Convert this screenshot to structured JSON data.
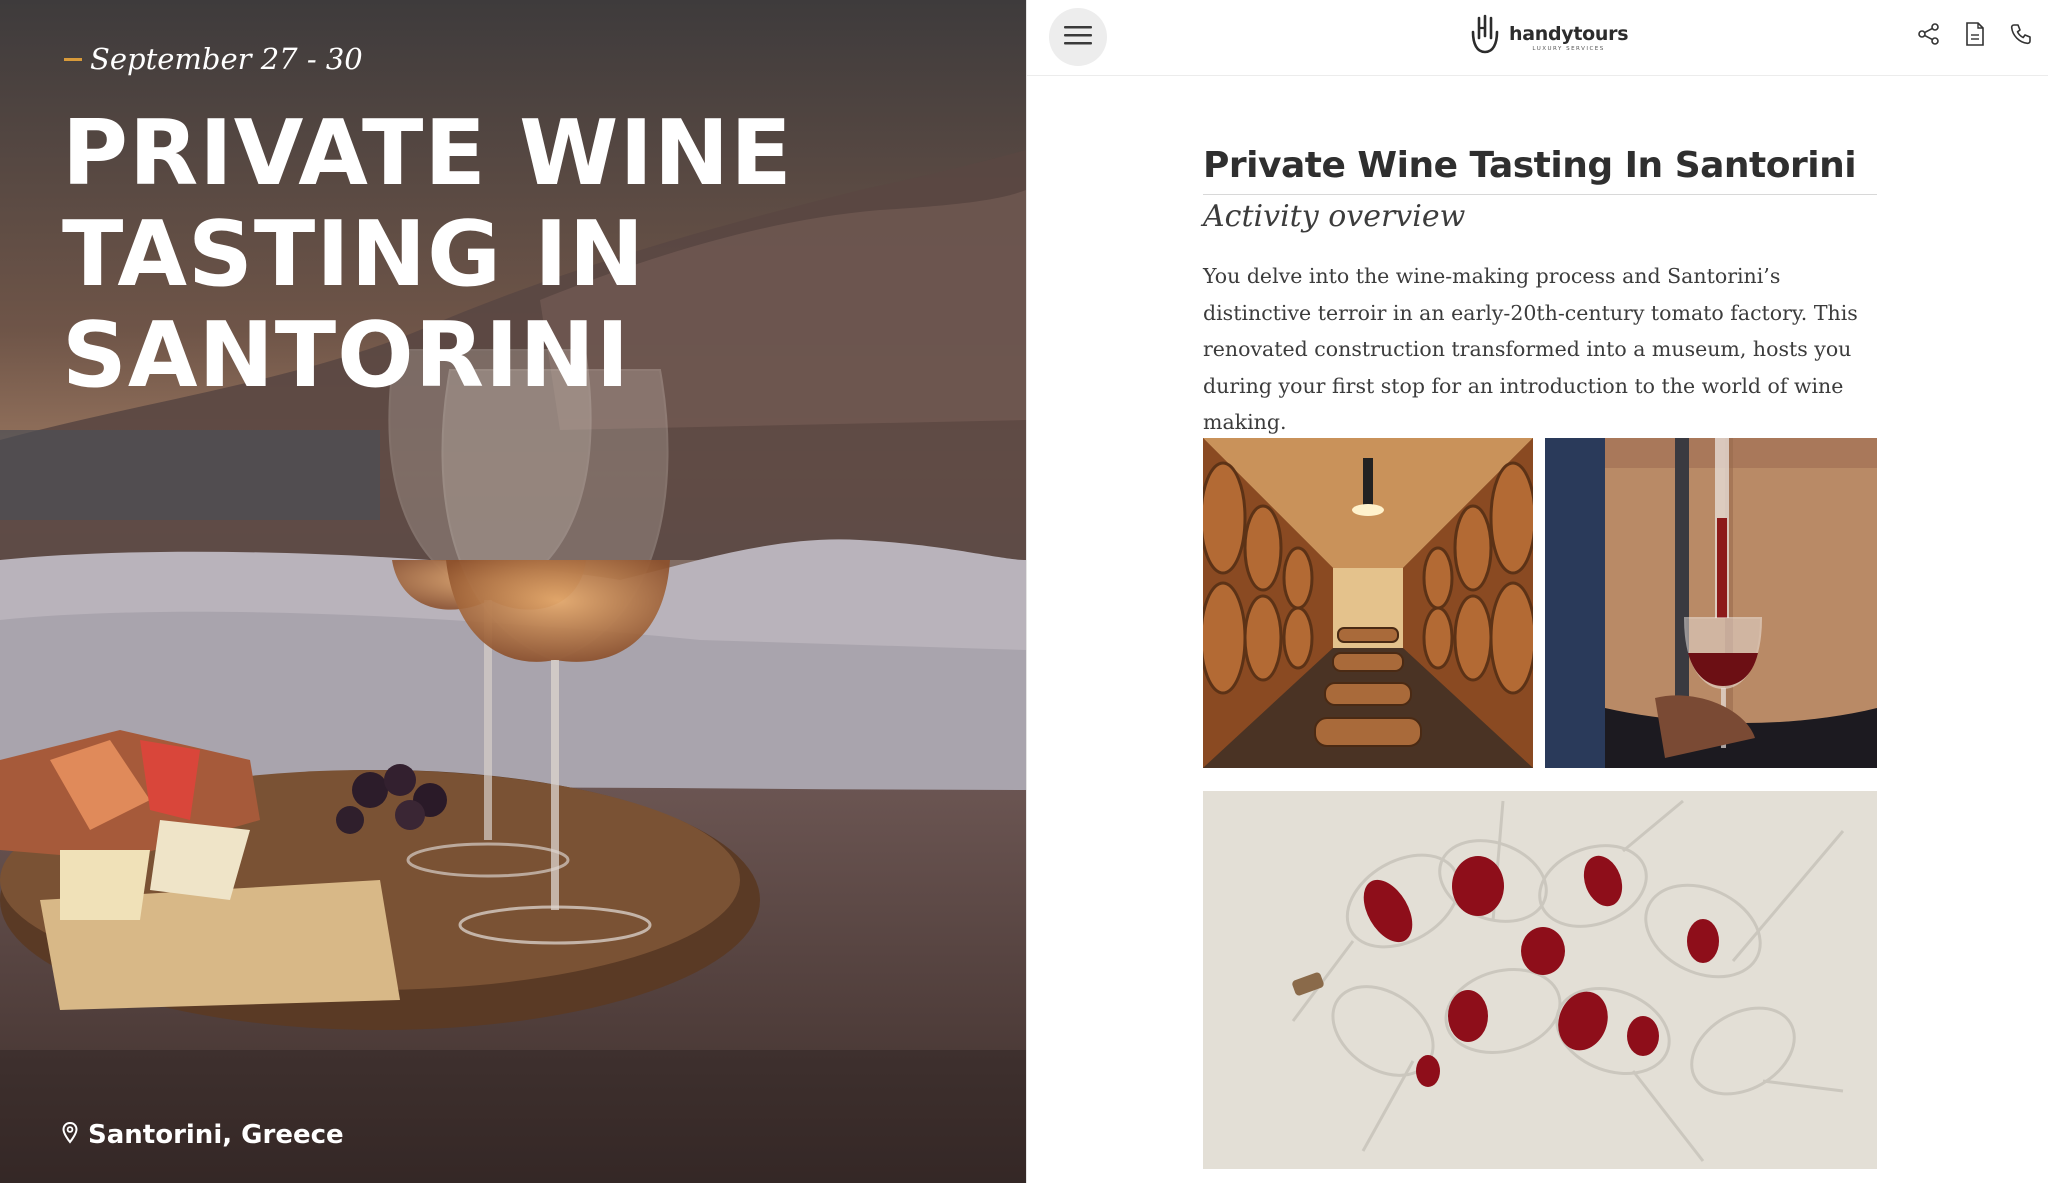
{
  "hero": {
    "date": "September 27 - 30",
    "title_lines": [
      "PRIVATE WINE",
      "TASTING IN",
      "SANTORINI"
    ],
    "location": "Santorini, Greece",
    "location_icon": "map-pin-icon",
    "accent_color": "#d89a3a"
  },
  "header": {
    "menu_icon": "hamburger-menu-icon",
    "logo_name": "handytours",
    "logo_sub": "LUXURY SERVICES",
    "icons": [
      "share-icon",
      "document-icon",
      "phone-icon"
    ]
  },
  "content": {
    "title": "Private Wine Tasting In Santorini",
    "subtitle": "Activity overview",
    "description": "You delve into the wine-making process and Santorini’s distinctive terroir in an early-20th-century tomato factory. This renovated construction transformed into a museum, hosts you during your first stop for an introduction to the world of wine making."
  }
}
